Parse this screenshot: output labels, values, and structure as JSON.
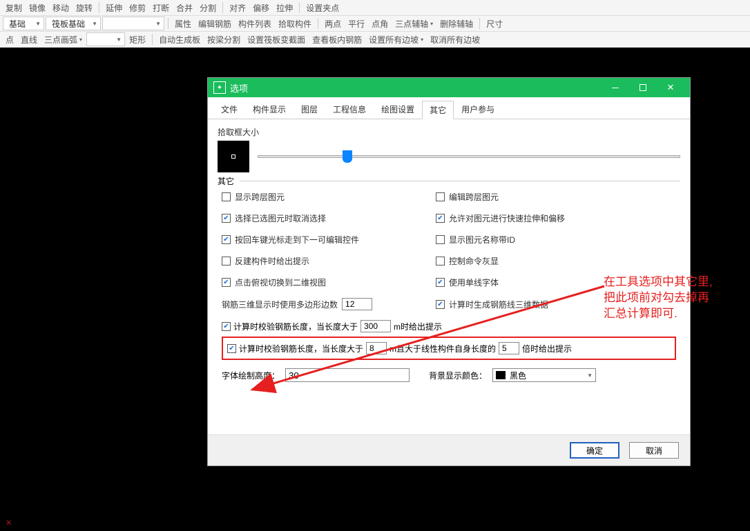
{
  "toolbar1": {
    "copy": "复制",
    "mirror": "镜像",
    "move": "移动",
    "rotate": "旋转",
    "extend": "延伸",
    "trim": "修剪",
    "break": "打断",
    "merge": "合并",
    "split": "分割",
    "align": "对齐",
    "offset": "偏移",
    "stretch": "拉伸",
    "setBasePoint": "设置夹点"
  },
  "toolbar2": {
    "base": "基础",
    "raftBase": "筏板基础",
    "properties": "属性",
    "editRebar": "编辑钢筋",
    "componentList": "构件列表",
    "pickComponent": "拾取构件",
    "twoPoint": "两点",
    "parallel": "平行",
    "pointAngle": "点角",
    "threePointAxis": "三点辅轴",
    "deleteAxis": "删除辅轴",
    "dimension": "尺寸"
  },
  "toolbar3": {
    "point": "点",
    "line": "直线",
    "threePointArc": "三点画弧",
    "rect": "矩形",
    "autoSlab": "自动生成板",
    "splitByBeam": "按梁分割",
    "setRaftSection": "设置筏板变截面",
    "viewSlabRebar": "查看板内钢筋",
    "setAllEdges": "设置所有边坡",
    "cancelAllEdges": "取消所有边坡"
  },
  "dialog": {
    "title": "选项",
    "tabs": {
      "file": "文件",
      "componentDisplay": "构件显示",
      "layer": "图层",
      "projectInfo": "工程信息",
      "drawSettings": "绘图设置",
      "other": "其它",
      "userParams": "用户参与"
    },
    "pickSizeLabel": "拾取框大小",
    "otherLegend": "其它",
    "opts": {
      "showCrossLayer": "显示跨层图元",
      "editCrossLayer": "编辑跨层图元",
      "selectSelectedCancel": "选择已选图元时取消选择",
      "allowQuickStretch": "允许对图元进行快速拉伸和偏移",
      "enterMovesNext": "按回车键光标走到下一可编辑控件",
      "showNameWithId": "显示图元名称带ID",
      "reverseComponentPrompt": "反建构件时给出提示",
      "controlCmdGray": "控制命令灰显",
      "clickOrthoTo2D": "点击俯视切换到二维视图",
      "useSingleLineFont": "使用单线字体",
      "rebar3dPolyLabel": "钢筋三维显示时使用多边形边数",
      "rebar3dPolyVal": "12",
      "calcGen3dData": "计算时生成钢筋线三维数据",
      "calcCheckLen1a": "计算时校验钢筋长度，当长度大于",
      "calcCheckLen1Val": "300",
      "calcCheckLen1b": "m时给出提示",
      "calcCheckLen2a": "计算时校验钢筋长度，当长度大于",
      "calcCheckLen2Val": "8",
      "calcCheckLen2b": "m且大于线性构件自身长度的",
      "calcCheckLen2Mult": "5",
      "calcCheckLen2c": "倍时给出提示",
      "textHeightLabel": "字体绘制高度：",
      "textHeightVal": "30",
      "bgColorLabel": "背景显示颜色：",
      "bgColorVal": "黑色"
    },
    "buttons": {
      "ok": "确定",
      "cancel": "取消"
    }
  },
  "annotation": {
    "line1": "在工具选项中其它里,",
    "line2": "把此项前对勾去掉再",
    "line3": "汇总计算即可."
  }
}
